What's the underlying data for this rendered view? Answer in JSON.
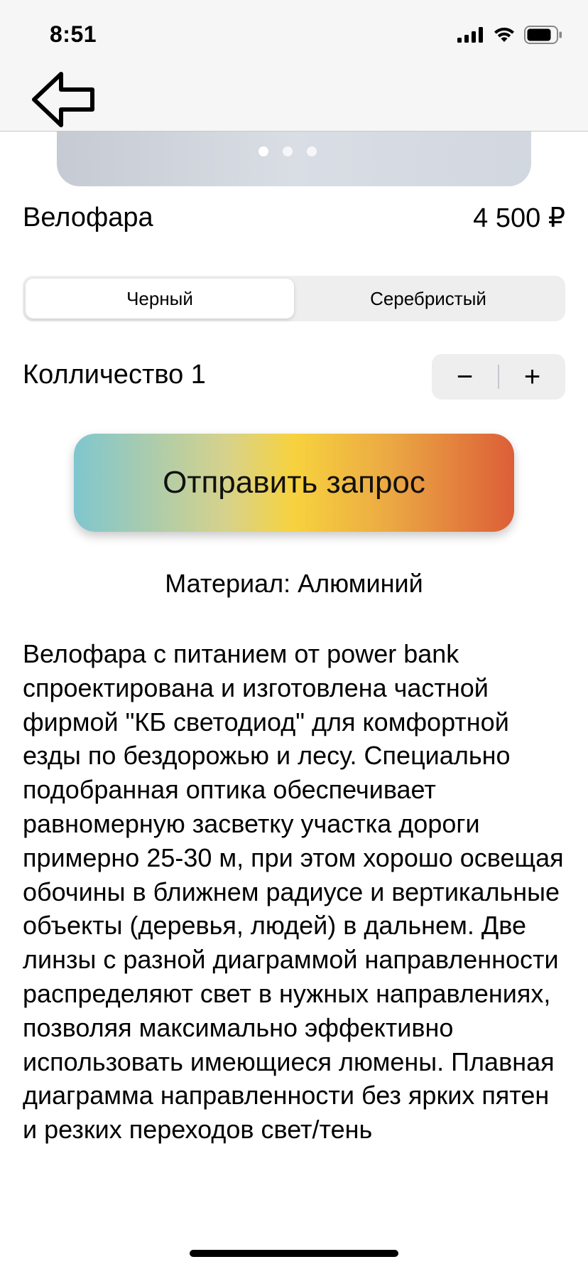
{
  "status_bar": {
    "time": "8:51"
  },
  "navigation": {
    "back_icon": "back-arrow-icon"
  },
  "carousel": {
    "page_count": 3,
    "active_page": 1
  },
  "product": {
    "title": "Велофара",
    "price": "4 500 ₽"
  },
  "color_selector": {
    "options": [
      "Черный",
      "Серебристый"
    ],
    "selected": "Черный"
  },
  "quantity": {
    "label": "Колличество 1",
    "decrement": "−",
    "increment": "+"
  },
  "request_button": {
    "label": "Отправить запрос"
  },
  "material": "Материал: Алюминий",
  "description": "Велофара с питанием от power bank спроектирована и изготовлена частной фирмой \"КБ светодиод\" для комфортной езды по бездорожью и лесу. Специально подобранная оптика обеспечивает равномерную засветку участка дороги примерно 25-30 м, при этом хорошо освещая обочины в ближнем радиусе и вертикальные объекты (деревья, людей) в дальнем. Две линзы с разной диаграммой направленности распределяют свет в нужных направлениях, позволяя максимально эффективно использовать имеющиеся люмены. Плавная диаграмма направленности без ярких пятен и резких переходов свет/тень"
}
